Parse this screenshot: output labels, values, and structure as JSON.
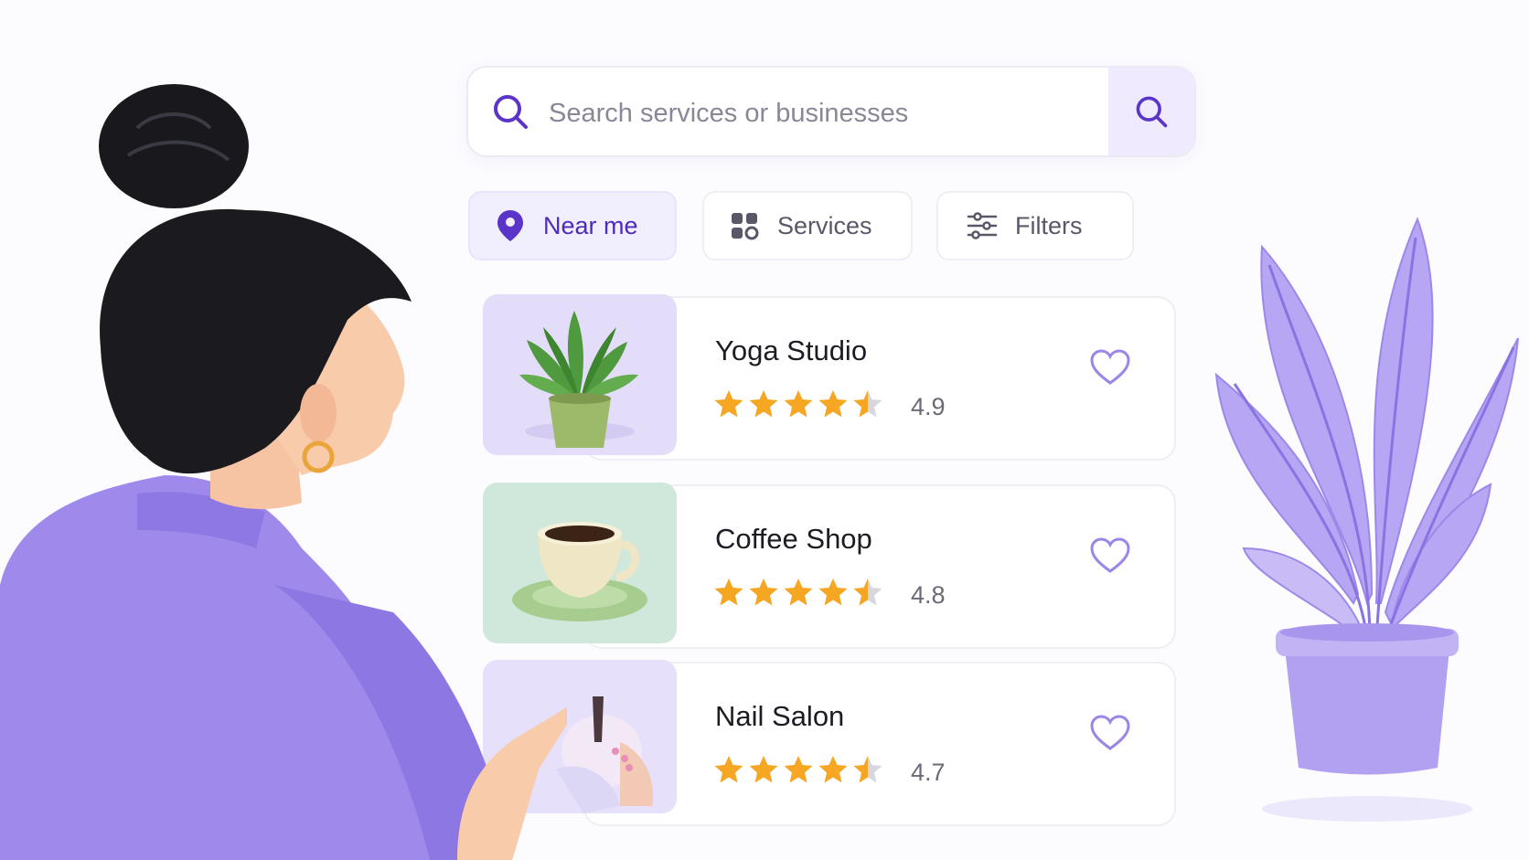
{
  "search": {
    "placeholder": "Search services or businesses",
    "icon": "search-icon"
  },
  "chips": [
    {
      "label": "Near me",
      "icon": "location-pin-icon",
      "active": true
    },
    {
      "label": "Services",
      "icon": "grid-icon",
      "active": false
    },
    {
      "label": "Filters",
      "icon": "sliders-icon",
      "active": false
    }
  ],
  "listings": [
    {
      "name": "Yoga Studio",
      "rating": "4.9",
      "stars": 4.5,
      "thumbnail": "potted-plant-image",
      "favorite": false
    },
    {
      "name": "Coffee Shop",
      "rating": "4.8",
      "stars": 4.5,
      "thumbnail": "coffee-cup-image",
      "favorite": false
    },
    {
      "name": "Nail Salon",
      "rating": "4.7",
      "stars": 4.5,
      "thumbnail": "manicure-image",
      "favorite": false
    }
  ],
  "colors": {
    "accent": "#5b35c9",
    "accent_soft": "#efeafd",
    "star": "#f5a623",
    "heart": "#9b85e6",
    "sweater": "#9f8aec",
    "plant": "#b4a3f1"
  }
}
